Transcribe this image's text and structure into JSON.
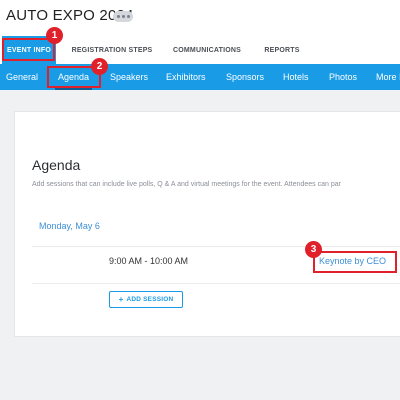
{
  "header": {
    "title": "AUTO EXPO 2024",
    "more_icon": "ellipsis-icon"
  },
  "tabs": [
    {
      "label": "EVENT INFO",
      "active": true
    },
    {
      "label": "REGISTRATION STEPS",
      "active": false
    },
    {
      "label": "COMMUNICATIONS",
      "active": false
    },
    {
      "label": "REPORTS",
      "active": false
    }
  ],
  "subnav": [
    {
      "label": "General",
      "active": false
    },
    {
      "label": "Agenda",
      "active": true
    },
    {
      "label": "Speakers",
      "active": false
    },
    {
      "label": "Exhibitors",
      "active": false
    },
    {
      "label": "Sponsors",
      "active": false
    },
    {
      "label": "Hotels",
      "active": false
    },
    {
      "label": "Photos",
      "active": false
    },
    {
      "label": "More I",
      "active": false
    }
  ],
  "agenda": {
    "title": "Agenda",
    "description": "Add sessions that can include live polls, Q & A and virtual meetings for the event. Attendees can par",
    "day": "Monday, May 6",
    "sessions": [
      {
        "time": "9:00 AM - 10:00 AM",
        "title": "Keynote by CEO"
      }
    ],
    "add_button": {
      "icon": "+",
      "label": "ADD SESSION"
    }
  },
  "annotations": [
    "1",
    "2",
    "3"
  ],
  "colors": {
    "accent": "#1a9be6",
    "link": "#3d8fd6",
    "highlight": "#e0202a",
    "background": "#f0f1f3"
  }
}
